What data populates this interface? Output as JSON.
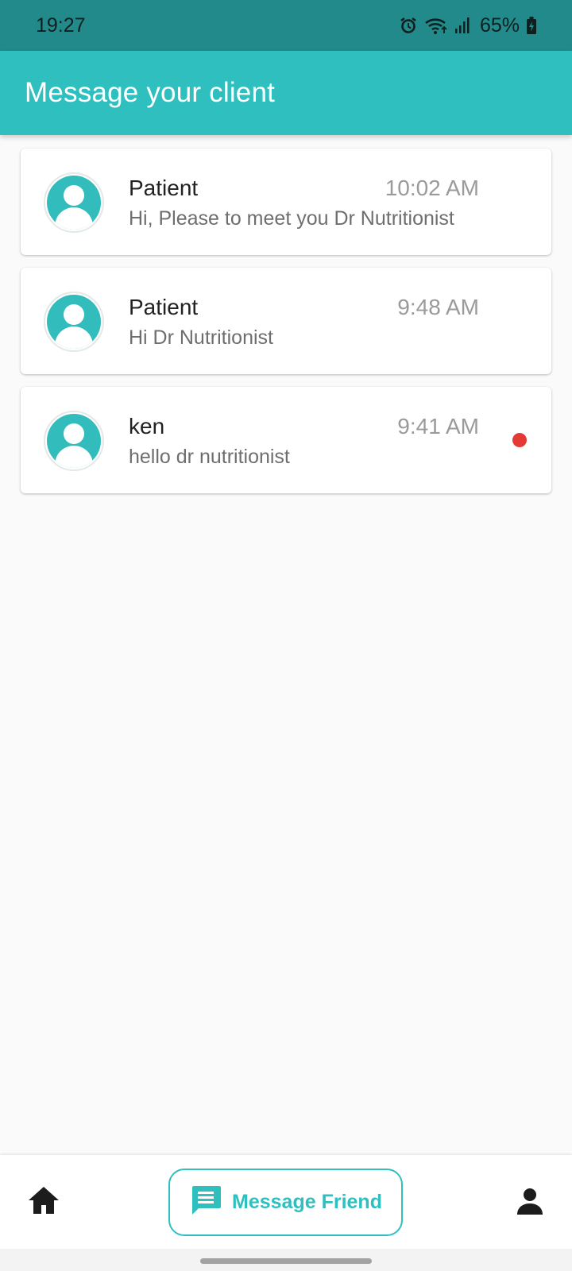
{
  "status_bar": {
    "time": "19:27",
    "battery": "65%",
    "icons": [
      "alarm-icon",
      "wifi-icon",
      "signal-icon",
      "battery-charging-icon"
    ]
  },
  "app_bar": {
    "title": "Message your client",
    "background": "#30bfbf"
  },
  "conversations": [
    {
      "name": "Patient",
      "time": "10:02 AM",
      "preview": "Hi, Please to meet you Dr Nutritionist",
      "unread": false
    },
    {
      "name": "Patient",
      "time": "9:48 AM",
      "preview": "Hi Dr Nutritionist",
      "unread": false
    },
    {
      "name": "ken",
      "time": "9:41 AM",
      "preview": "hello dr nutritionist",
      "unread": true
    }
  ],
  "bottom_nav": {
    "home_icon": "home-icon",
    "message_button_label": "Message Friend",
    "message_icon": "chat-icon",
    "profile_icon": "person-icon"
  },
  "colors": {
    "accent": "#30bfbf",
    "status_bar": "#228a8a",
    "unread": "#e53935"
  }
}
